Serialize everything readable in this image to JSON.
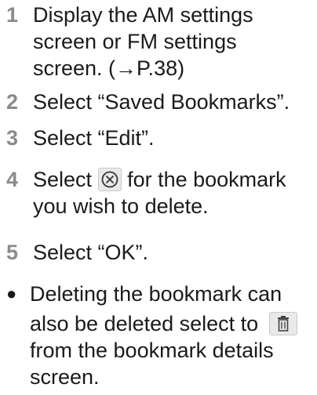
{
  "steps": [
    {
      "num": "1",
      "lines": [
        "Display the AM settings",
        "screen or FM settings",
        "screen. (→P.38)"
      ]
    },
    {
      "num": "2",
      "text": "Select “Saved Bookmarks”."
    },
    {
      "num": "3",
      "text": "Select “Edit”."
    },
    {
      "num": "4",
      "pre": "Select",
      "post": "for the bookmark",
      "line2": "you wish to delete.",
      "icon": "delete-x-icon"
    },
    {
      "num": "5",
      "text": "Select “OK”."
    }
  ],
  "note": {
    "bullet": "●",
    "line1": "Deleting the bookmark can",
    "line2": "also be deleted select to",
    "line3": "from the bookmark details",
    "line4": "screen.",
    "icon": "trash-icon"
  },
  "colors": {
    "step_number": "#8a8a8a",
    "text": "#1a1a1a",
    "icon_bg": "#e9e9e9"
  }
}
